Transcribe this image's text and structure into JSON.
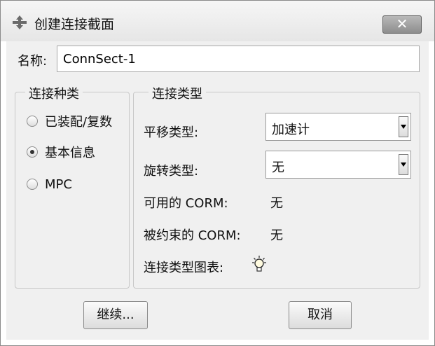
{
  "window": {
    "title": "创建连接截面",
    "close_label": "✕"
  },
  "name_field": {
    "label": "名称:",
    "value": "ConnSect-1"
  },
  "connection_category": {
    "title": "连接种类",
    "options": [
      {
        "label": "已装配/复数",
        "checked": false
      },
      {
        "label": "基本信息",
        "checked": true
      },
      {
        "label": "MPC",
        "checked": false
      }
    ]
  },
  "connection_type": {
    "title": "连接类型",
    "translational_label": "平移类型:",
    "translational_value": "加速计",
    "rotational_label": "旋转类型:",
    "rotational_value": "无",
    "available_corm_label": "可用的 CORM:",
    "available_corm_value": "无",
    "constrained_corm_label": "被约束的 CORM:",
    "constrained_corm_value": "无",
    "chart_label": "连接类型图表:"
  },
  "buttons": {
    "continue": "继续...",
    "cancel": "取消"
  }
}
